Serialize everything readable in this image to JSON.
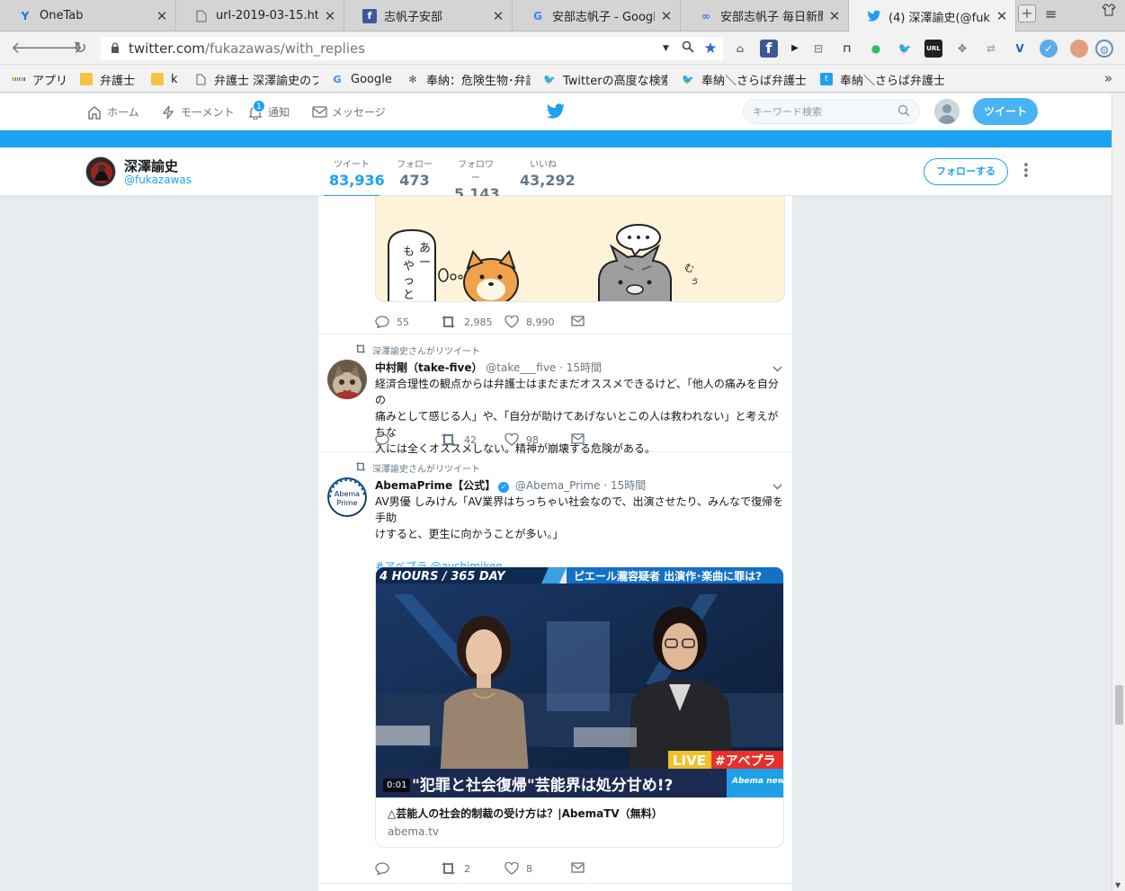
{
  "browser": {
    "tabs": [
      {
        "title": "OneTab",
        "icon": "onetab-icon"
      },
      {
        "title": "url-2019-03-15.html",
        "icon": "file-icon"
      },
      {
        "title": "志帆子安部",
        "icon": "facebook-icon"
      },
      {
        "title": "安部志帆子 - Google",
        "icon": "google-icon"
      },
      {
        "title": "安部志帆子 毎日新聞",
        "icon": "link-icon"
      },
      {
        "title": "(4) 深澤諭史(@fukaz",
        "icon": "twitter-icon"
      }
    ],
    "url_host": "twitter.com",
    "url_path": "/fukazawas/with_replies",
    "bookmarks": [
      {
        "label": "アプリ",
        "icon": "apps-grid-icon"
      },
      {
        "label": "弁護士",
        "icon": "folder-icon"
      },
      {
        "label": "k",
        "icon": "folder-icon"
      },
      {
        "label": "弁護士 深澤諭史のブ",
        "icon": "file-icon"
      },
      {
        "label": "Google",
        "icon": "google-icon"
      },
      {
        "label": "奉納：危険生物･弁護",
        "icon": "bug-icon"
      },
      {
        "label": "Twitterの高度な検索",
        "icon": "twitter-icon"
      },
      {
        "label": "奉納＼さらば弁護士",
        "icon": "twitter-icon"
      },
      {
        "label": "奉納＼さらば弁護士",
        "icon": "t-square-icon"
      }
    ]
  },
  "twitter_nav": {
    "home": "ホーム",
    "moments": "モーメント",
    "notifications": "通知",
    "notifications_badge": "1",
    "messages": "メッセージ",
    "search_placeholder": "キーワード検索",
    "tweet_button": "ツイート"
  },
  "profile": {
    "name": "深澤諭史",
    "handle": "@fukazawas",
    "stats": [
      {
        "label": "ツイート",
        "value": "83,936"
      },
      {
        "label": "フォロー",
        "value": "473"
      },
      {
        "label": "フォロワー",
        "value": "5,143"
      },
      {
        "label": "いいね",
        "value": "43,292"
      }
    ],
    "follow_button": "フォローする"
  },
  "tweets": [
    {
      "replies": "55",
      "retweets": "2,985",
      "likes": "8,990"
    },
    {
      "context": "深澤諭史さんがリツイート",
      "name": "中村剛（take-five）",
      "handle": "@take___five",
      "time": "· 15時間",
      "lines": [
        "経済合理性の観点からは弁護士はまだまだオススメできるけど、「他人の痛みを自分の",
        "痛みとして感じる人」や、「自分が助けてあげないとこの人は救われない」と考えがちな",
        "人には全くオススメしない。精神が崩壊する危険がある。"
      ],
      "replies": "",
      "retweets": "42",
      "likes": "98"
    },
    {
      "context": "深澤諭史さんがリツイート",
      "name": "AbemaPrime【公式】",
      "handle": "@Abema_Prime",
      "time": "· 15時間",
      "lines": [
        "AV男優 しみけん「AV業界はちっちゃい社会なので、出演させたり、みんなで復帰を手助",
        "けすると、更生に向かうことが多い。」"
      ],
      "hashtags": "#アベプラ @avshimiken",
      "video": {
        "ticker": "4 HOURS / 365 DAY",
        "headline": "ピエール瀧容疑者 出演作･楽曲に罪は?",
        "live": "LIVE",
        "live_tag": "#アベプラ",
        "caption": "\"犯罪と社会復帰\"芸能界は処分甘め!?",
        "news_logo": "Abema news",
        "duration": "0:01",
        "card_title": "△芸能人の社会的制裁の受け方は？|AbemaTV（無料）",
        "card_domain": "abema.tv"
      },
      "replies": "",
      "retweets": "2",
      "likes": "8"
    }
  ],
  "colors": {
    "twitter_blue": "#1da1f2",
    "timeline_bg": "#e6ecf0"
  }
}
